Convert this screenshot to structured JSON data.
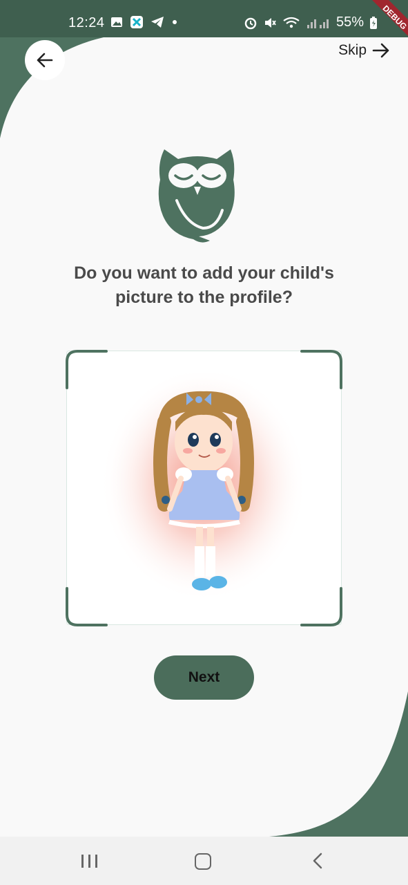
{
  "status_bar": {
    "time": "12:24",
    "battery": "55%",
    "icons": [
      "image-icon",
      "app-icon",
      "telegram-icon",
      "dot-icon",
      "alarm-icon",
      "mute-icon",
      "wifi-icon",
      "signal-icon",
      "battery-icon"
    ]
  },
  "debug_banner": "DEBUG",
  "header": {
    "back_icon": "arrow-left-icon",
    "skip_label": "Skip",
    "skip_icon": "arrow-right-icon"
  },
  "logo": "owl-logo",
  "question": {
    "line1": "Do you want to add your child's",
    "line2": "picture to the profile?"
  },
  "photo": {
    "content": "child-illustration"
  },
  "next_button": {
    "label": "Next"
  },
  "colors": {
    "brand_green": "#4e7260",
    "sheet": "#f9f9f9",
    "button": "#4b6d5b",
    "text": "#4a4a4a"
  },
  "nav_bar": {
    "icons": [
      "recents-icon",
      "home-icon",
      "back-icon"
    ]
  }
}
